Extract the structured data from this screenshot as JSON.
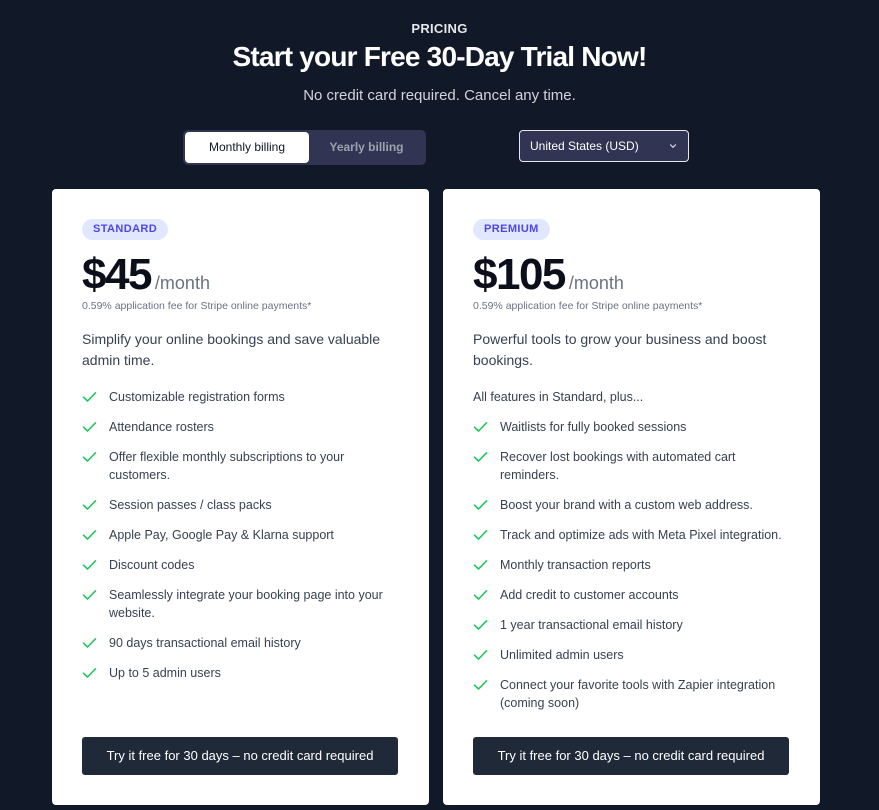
{
  "header": {
    "eyebrow": "PRICING",
    "title": "Start your Free 30-Day Trial Now!",
    "subtitle": "No credit card required. Cancel any time."
  },
  "billing": {
    "monthly_label": "Monthly billing",
    "yearly_label": "Yearly billing",
    "selected": "monthly"
  },
  "currency": {
    "selected": "United States (USD)"
  },
  "plans": {
    "standard": {
      "badge": "STANDARD",
      "price": "$45",
      "period": "/month",
      "fee_note": "0.59% application fee for Stripe online payments*",
      "description": "Simplify your online bookings and save valuable admin time.",
      "features": [
        "Customizable registration forms",
        "Attendance rosters",
        "Offer flexible monthly subscriptions to your customers.",
        "Session passes / class packs",
        "Apple Pay, Google Pay & Klarna support",
        "Discount codes",
        "Seamlessly integrate your booking page into your website.",
        "90 days transactional email history",
        "Up to 5 admin users"
      ],
      "cta": "Try it free for 30 days – no credit card required"
    },
    "premium": {
      "badge": "PREMIUM",
      "price": "$105",
      "period": "/month",
      "fee_note": "0.59% application fee for Stripe online payments*",
      "description": "Powerful tools to grow your business and boost bookings.",
      "features_lead": "All features in Standard, plus...",
      "features": [
        "Waitlists for fully booked sessions",
        "Recover lost bookings with automated cart reminders.",
        "Boost your brand with a custom web address.",
        "Track and optimize ads with Meta Pixel integration.",
        "Monthly transaction reports",
        "Add credit to customer accounts",
        "1 year transactional email history",
        "Unlimited admin users",
        "Connect your favorite tools with Zapier integration (coming soon)"
      ],
      "cta": "Try it free for 30 days – no credit card required"
    }
  },
  "colors": {
    "background": "#111827",
    "check": "#22c55e",
    "badge_bg": "#e0e7ff",
    "badge_text": "#4f46e5",
    "cta_bg": "#1f2937"
  },
  "icons": {
    "feature_bullet": "check-icon",
    "currency_dropdown": "chevron-down-icon"
  }
}
